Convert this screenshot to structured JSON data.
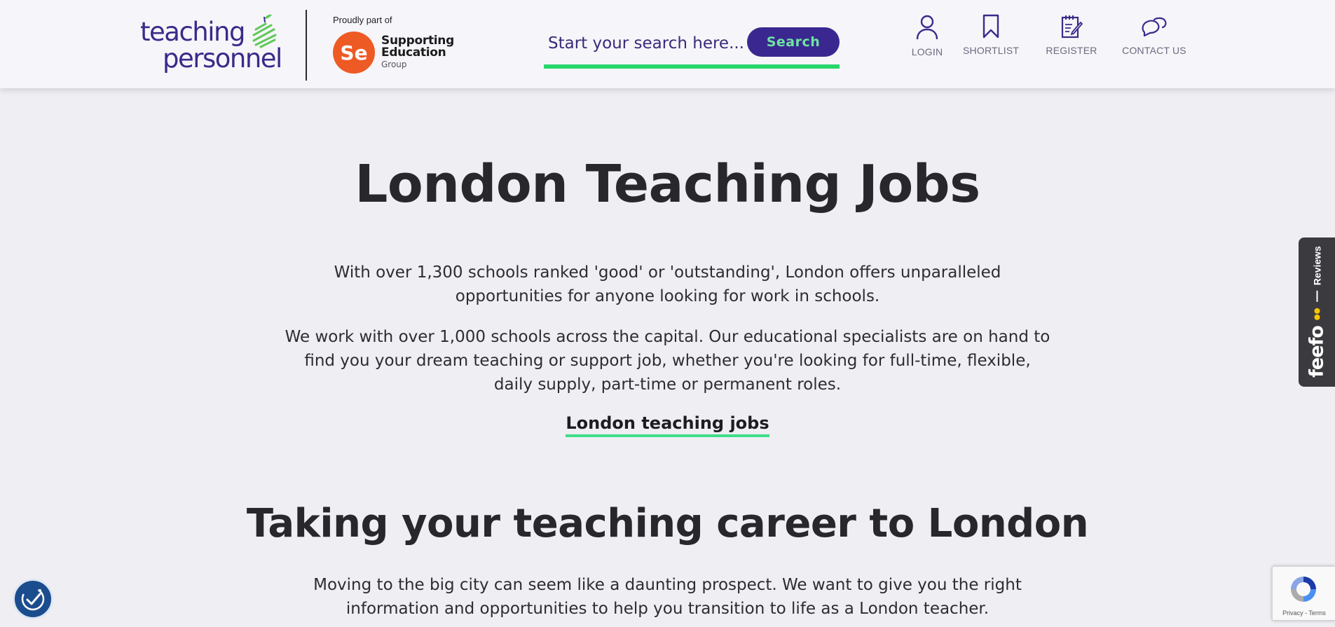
{
  "header": {
    "logo": {
      "line1": "teaching",
      "line2": "personnel"
    },
    "proudly_part_of": "Proudly part of",
    "se_group": {
      "line1": "Supporting",
      "line2": "Education",
      "line3": "Group",
      "monogram": "Se"
    },
    "search": {
      "placeholder": "Start your search here...",
      "button_label": "Search"
    },
    "nav": [
      {
        "label": "LOGIN",
        "icon": "user-icon"
      },
      {
        "label": "SHORTLIST",
        "icon": "bookmark-icon"
      },
      {
        "label": "REGISTER",
        "icon": "register-form-icon"
      },
      {
        "label": "CONTACT US",
        "icon": "chat-bubbles-icon"
      }
    ]
  },
  "main": {
    "title": "London Teaching Jobs",
    "paragraph1": "With over 1,300 schools ranked 'good' or 'outstanding', London offers unparalleled opportunities for anyone looking for work in schools.",
    "paragraph2": "We work with over 1,000 schools across the capital. Our educational specialists are on hand to find you your dream teaching or support job, whether you're looking for full-time, flexible, daily supply, part-time or permanent roles.",
    "jobs_link": "London teaching jobs",
    "section_title_regular": "Taking your teaching career ",
    "section_title_bold": "to London",
    "paragraph3": "Moving to the big city can seem like a daunting prospect. We want to give you the right information and opportunities to help you transition to life as a London teacher."
  },
  "widgets": {
    "feefo": {
      "logo": "feefo",
      "label": "Reviews"
    },
    "recaptcha": {
      "links": "Privacy - Terms"
    },
    "accessibility": {
      "icon": "accessibility-icon"
    }
  },
  "colors": {
    "brand_purple": "#3a2890",
    "accent_green": "#27d66b",
    "se_orange": "#ee5a24",
    "background": "#efeef3"
  }
}
